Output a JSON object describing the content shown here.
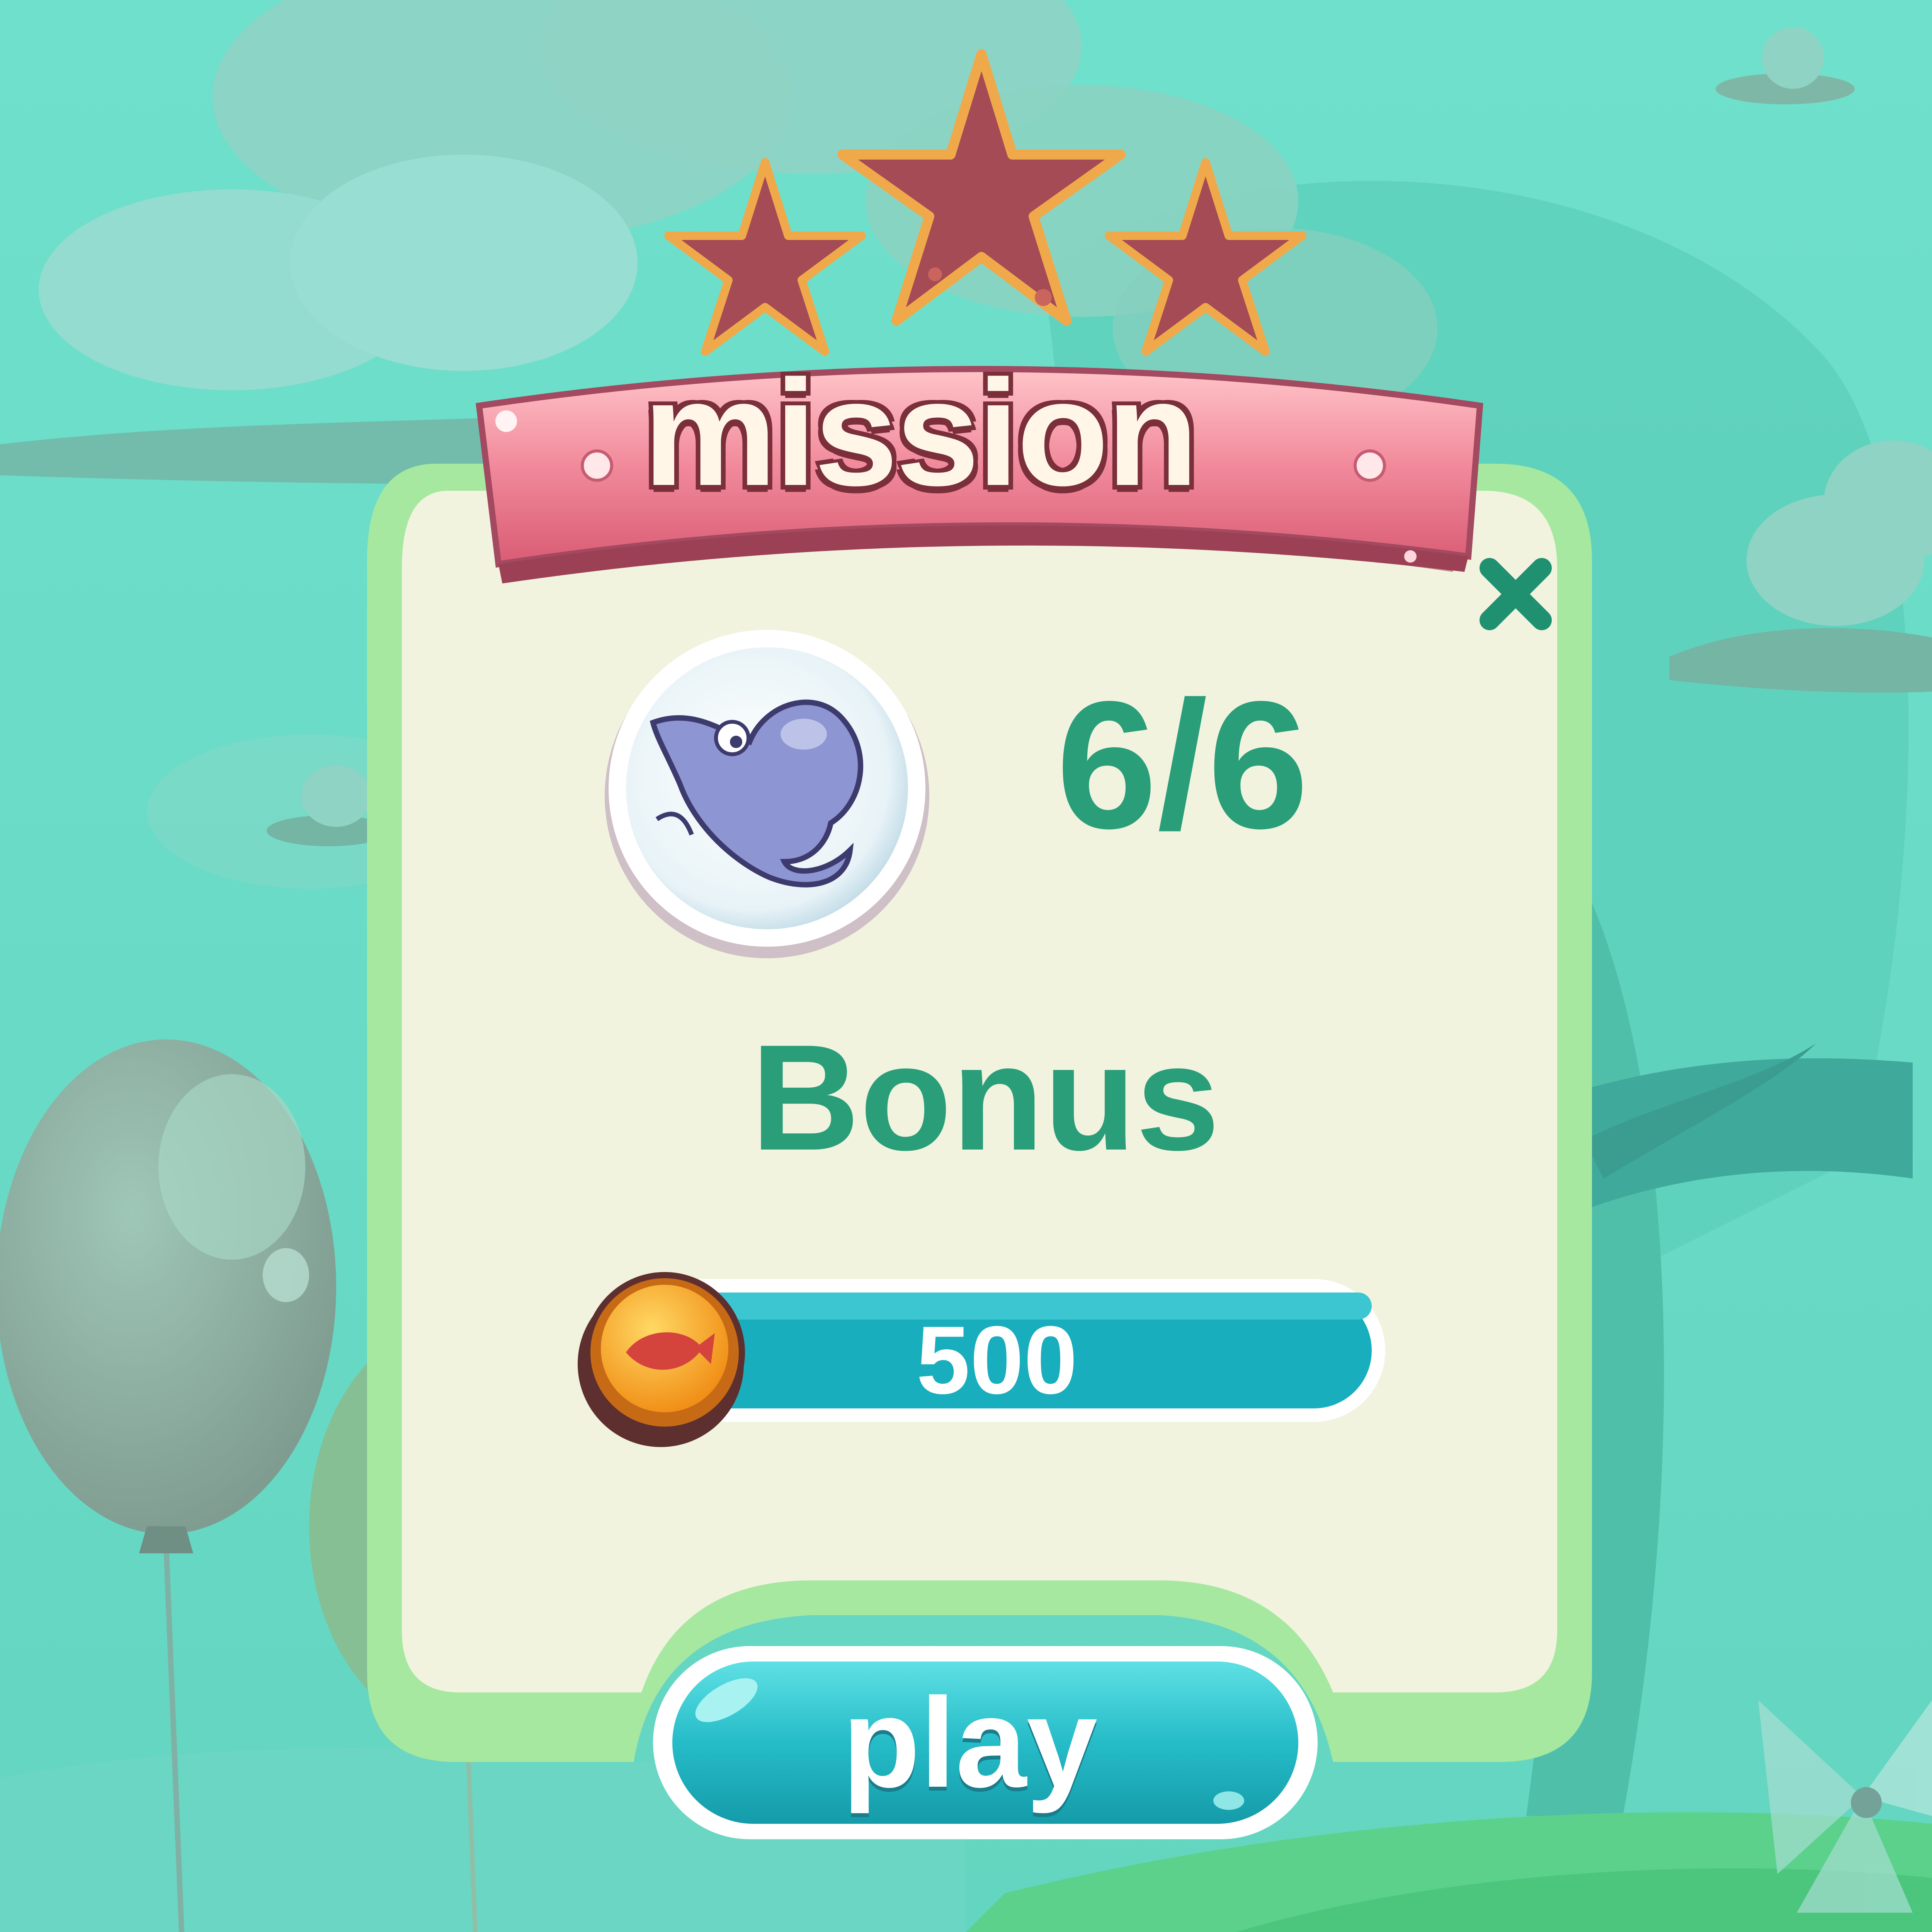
{
  "game": {
    "screen": "mission-complete",
    "title": "mission",
    "stars_earned": 3,
    "stars_total": 3,
    "goal": {
      "icon": "fish-bubble-icon",
      "progress": "6/6"
    },
    "bonus": {
      "label": "Bonus",
      "coin_icon": "fish-coin-icon",
      "amount": "500"
    },
    "buttons": {
      "play_label": "play",
      "close_icon": "close-icon"
    }
  },
  "colors": {
    "background": "#6fd9c6",
    "star_fill": "#a44b55",
    "star_outline": "#f0a94a",
    "banner_pink": "#ee7f91",
    "panel_border": "#a6e8a0",
    "panel_fill": "#f1f3df",
    "text_green": "#2a9e79",
    "reward_bar": "#19aebd",
    "coin_gold": "#f6a11e",
    "play_button": "#1cb2c1"
  }
}
